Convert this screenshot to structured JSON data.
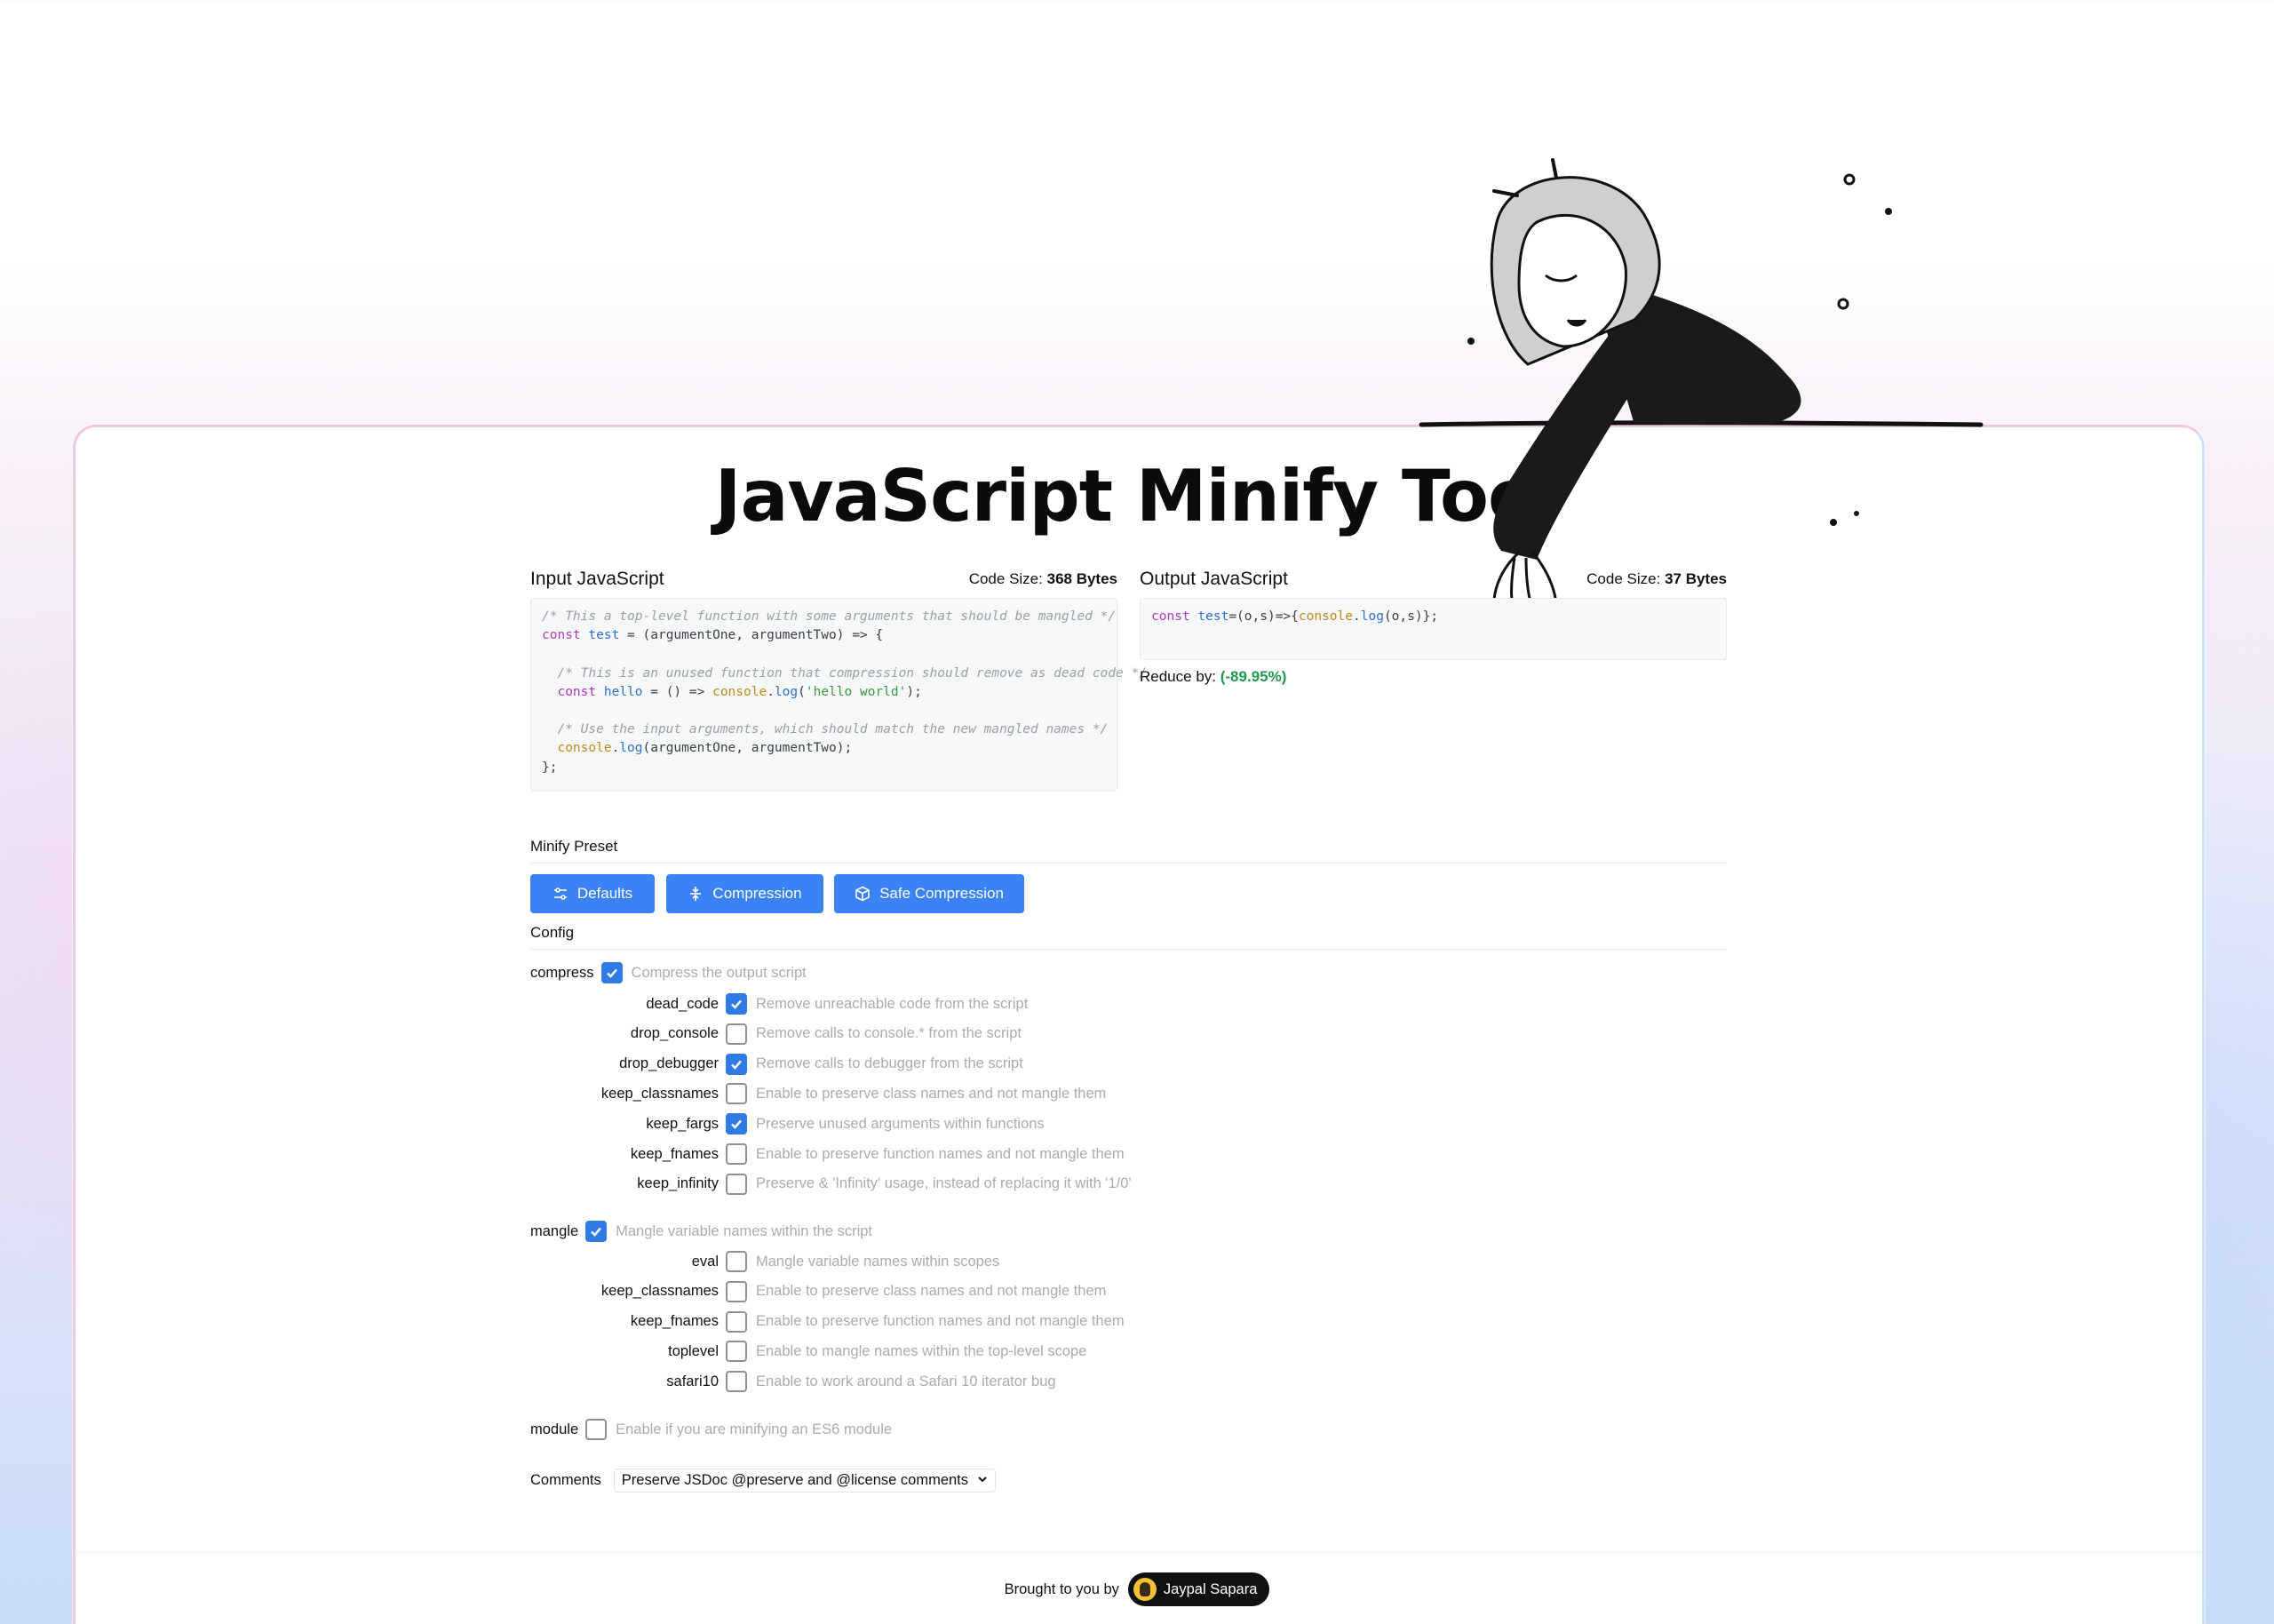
{
  "title": "JavaScript Minify Tool",
  "input": {
    "label": "Input JavaScript",
    "size_prefix": "Code Size:",
    "size_value": "368 Bytes"
  },
  "output": {
    "label": "Output JavaScript",
    "size_prefix": "Code Size:",
    "size_value": "37 Bytes",
    "reduce_label": "Reduce by:",
    "reduce_value": "(-89.95%)"
  },
  "presets": {
    "title": "Minify Preset",
    "buttons": [
      "Defaults",
      "Compression",
      "Safe Compression"
    ]
  },
  "config": {
    "title": "Config",
    "compress": {
      "name": "compress",
      "checked": true,
      "desc": "Compress the output script",
      "options": [
        {
          "name": "dead_code",
          "checked": true,
          "desc": "Remove unreachable code from the script"
        },
        {
          "name": "drop_console",
          "checked": false,
          "desc": "Remove calls to console.* from the script"
        },
        {
          "name": "drop_debugger",
          "checked": true,
          "desc": "Remove calls to debugger from the script"
        },
        {
          "name": "keep_classnames",
          "checked": false,
          "desc": "Enable to preserve class names and not mangle them"
        },
        {
          "name": "keep_fargs",
          "checked": true,
          "desc": "Preserve unused arguments within functions"
        },
        {
          "name": "keep_fnames",
          "checked": false,
          "desc": "Enable to preserve function names and not mangle them"
        },
        {
          "name": "keep_infinity",
          "checked": false,
          "desc": "Preserve & 'Infinity' usage, instead of replacing it with '1/0'"
        }
      ]
    },
    "mangle": {
      "name": "mangle",
      "checked": true,
      "desc": "Mangle variable names within the script",
      "options": [
        {
          "name": "eval",
          "checked": false,
          "desc": "Mangle variable names within scopes"
        },
        {
          "name": "keep_classnames",
          "checked": false,
          "desc": "Enable to preserve class names and not mangle them"
        },
        {
          "name": "keep_fnames",
          "checked": false,
          "desc": "Enable to preserve function names and not mangle them"
        },
        {
          "name": "toplevel",
          "checked": false,
          "desc": "Enable to mangle names within the top-level scope"
        },
        {
          "name": "safari10",
          "checked": false,
          "desc": "Enable to work around a Safari 10 iterator bug"
        }
      ]
    },
    "module": {
      "name": "module",
      "checked": false,
      "desc": "Enable if you are minifying an ES6 module"
    },
    "comments": {
      "label": "Comments",
      "selected": "Preserve JSDoc @preserve and @license comments"
    }
  },
  "footer": {
    "prefix": "Brought to you by",
    "author": "Jaypal Sapara"
  },
  "colors": {
    "accent": "#3b82f6",
    "checkbox_on": "#2f7ae5",
    "reduce_green": "#1f9a4c"
  }
}
